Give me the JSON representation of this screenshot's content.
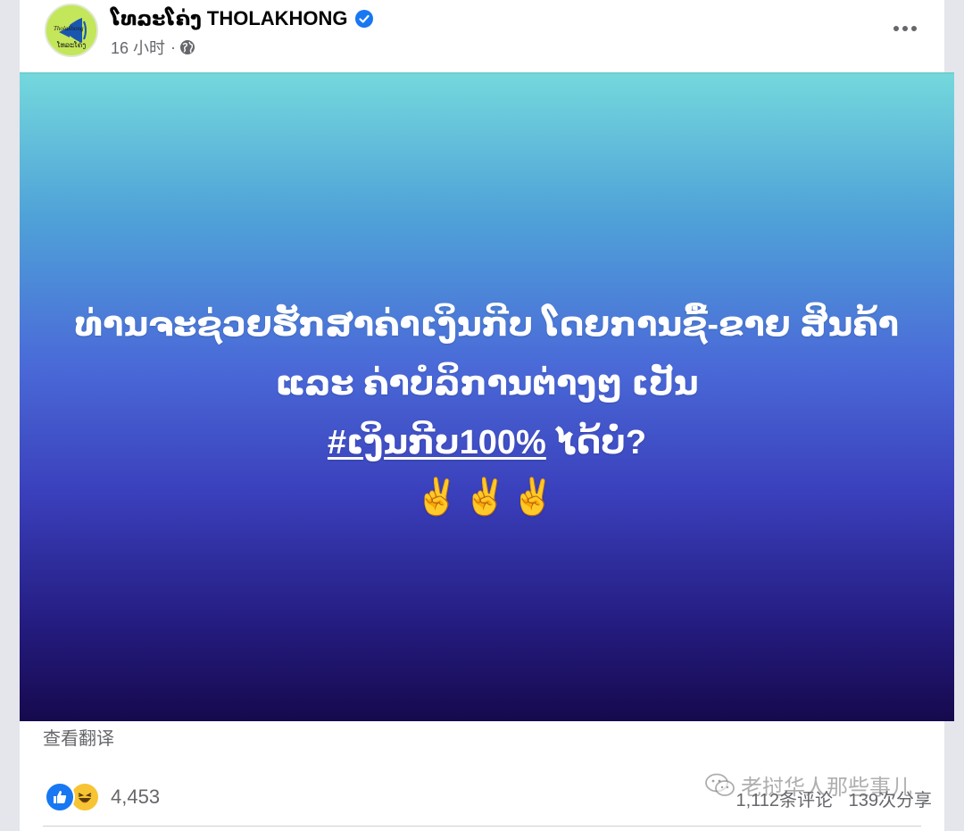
{
  "post": {
    "author": "ໂທລະໂຄ່ງ THOLAKHONG",
    "verified": true,
    "timestamp": "16 小时",
    "separator": "·",
    "privacy_icon": "globe-icon",
    "more_icon": "more-horizontal-icon",
    "avatar": {
      "logo_text_top": "Tholakhong",
      "logo_text_bottom": "ໂທລະໂຄ່ງ",
      "background": "#c4e65a"
    },
    "image": {
      "line1": "ທ່ານຈະຊ່ວຍຮັກສາຄ່າເງິນກີບ ໂດຍການຊື້-ຂາຍ ສິນຄ້າ",
      "line2": "ແລະ ຄ່າບໍລິການຕ່າງໆ ເປັນ",
      "hashtag": "#ເງິນກີບ100%",
      "line3_rest": " ໄດ້ບໍ່?",
      "emojis": "✌️✌️✌️",
      "gradient_top": "#74d8dc",
      "gradient_bottom": "#16094d"
    },
    "translate_label": "查看翻译",
    "reactions": {
      "icons": [
        "like-icon",
        "haha-icon"
      ],
      "count": "4,453"
    },
    "engagement": {
      "comments": "1,112条评论",
      "shares": "139次分享"
    },
    "watermark": "老挝华人那些事儿"
  },
  "colors": {
    "facebook_blue": "#1877f2",
    "secondary_text": "#65676b",
    "primary_text": "#050505"
  }
}
